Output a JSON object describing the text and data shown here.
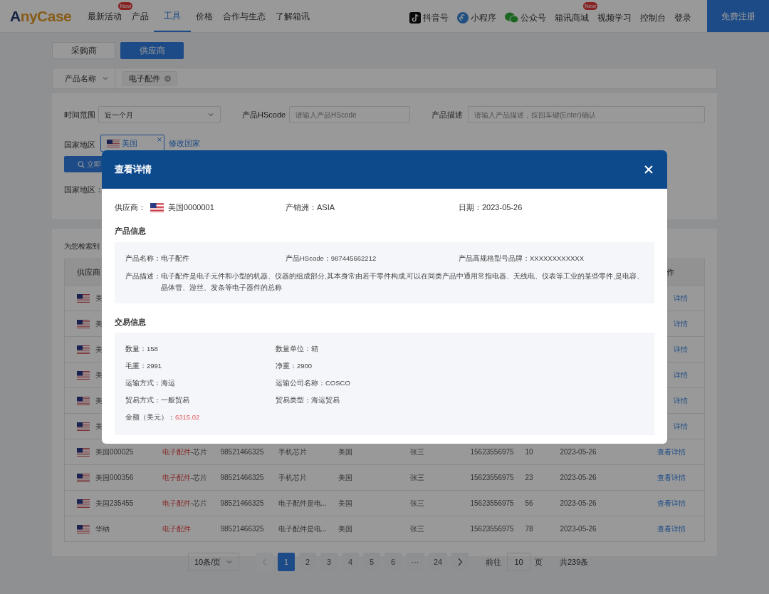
{
  "header": {
    "logo": "AnyCase",
    "nav": [
      {
        "label": "最新活动",
        "badge": "New",
        "selected": false
      },
      {
        "label": "产品",
        "selected": false
      },
      {
        "label": "工具",
        "selected": true
      },
      {
        "label": "价格",
        "selected": false
      },
      {
        "label": "合作与生态",
        "selected": false
      },
      {
        "label": "了解箱讯",
        "selected": false
      }
    ],
    "links": [
      {
        "label": "抖音号"
      },
      {
        "label": "小程序"
      },
      {
        "label": "公众号"
      },
      {
        "label": "箱讯商城",
        "badge": "New"
      },
      {
        "label": "视频学习"
      },
      {
        "label": "控制台"
      },
      {
        "label": "登录"
      }
    ],
    "register_button": "免费注册"
  },
  "role_tabs": [
    {
      "label": "采购商",
      "selected": false
    },
    {
      "label": "供应商",
      "selected": true
    }
  ],
  "filter_bar": {
    "field": "产品名称",
    "tag": "电子配件"
  },
  "filters": {
    "time_range": {
      "label": "时间范围",
      "value": "近一个月"
    },
    "hscode": {
      "label": "产品HScode",
      "placeholder": "请输入产品HScode"
    },
    "description": {
      "label": "产品描述",
      "placeholder": "请输入产品描述，按回车键(Enter)确认"
    },
    "country": {
      "label": "国家地区",
      "tag": "美国",
      "link": "修改国家"
    },
    "search_button": "立即",
    "country_summary": "国家地区："
  },
  "results": {
    "summary": "为您检索到",
    "columns": [
      "供应商",
      "作"
    ],
    "rows": [
      {
        "kind": "covered",
        "supplier": "美",
        "action": "详情"
      },
      {
        "kind": "covered",
        "supplier": "美",
        "action": "详情"
      },
      {
        "kind": "covered",
        "supplier": "美",
        "action": "详情"
      },
      {
        "kind": "covered",
        "supplier": "美",
        "action": "详情"
      },
      {
        "kind": "covered",
        "supplier": "美",
        "action": "详情"
      },
      {
        "kind": "covered",
        "supplier": "美",
        "action": "详情"
      },
      {
        "kind": "full",
        "supplier": "美国000025",
        "product": "电子配件",
        "product_suffix": "-芯片",
        "hscode": "98521466325",
        "description": "手机芯片",
        "country": "美国",
        "contact": "张三",
        "phone": "15623556975",
        "quantity": "10",
        "date": "2023-05-26",
        "action": "查看详情"
      },
      {
        "kind": "full",
        "supplier": "美国000356",
        "product": "电子配件",
        "product_suffix": "-芯片",
        "hscode": "98521466325",
        "description": "手机芯片",
        "country": "美国",
        "contact": "张三",
        "phone": "15623556975",
        "quantity": "23",
        "date": "2023-05-26",
        "action": "查看详情"
      },
      {
        "kind": "full",
        "supplier": "美国235455",
        "product": "电子配件",
        "product_suffix": "-芯片",
        "hscode": "98521466325",
        "description": "电子配件是电...",
        "country": "美国",
        "contact": "张三",
        "phone": "15623556975",
        "quantity": "56",
        "date": "2023-05-26",
        "action": "查看详情"
      },
      {
        "kind": "full",
        "supplier": "华纳",
        "product": "电子配件",
        "hscode": "98521466325",
        "description": "电子配件是电...",
        "country": "美国",
        "contact": "张三",
        "phone": "15623556975",
        "quantity": "78",
        "date": "2023-05-26",
        "action": "查看详情"
      }
    ]
  },
  "pagination": {
    "page_size": "10条/页",
    "prev": {
      "disabled": true
    },
    "pages": [
      {
        "label": "1",
        "selected": true
      },
      {
        "label": "2",
        "selected": false
      },
      {
        "label": "3",
        "selected": false
      },
      {
        "label": "4",
        "selected": false
      },
      {
        "label": "5",
        "selected": false
      },
      {
        "label": "6",
        "selected": false
      },
      {
        "label": "···",
        "selected": false
      },
      {
        "label": "24",
        "selected": false
      }
    ],
    "next": {
      "disabled": false
    },
    "goto_label": "前往",
    "goto_value": "10",
    "goto_unit": "页",
    "total": "共239条"
  },
  "modal": {
    "title": "查看详情",
    "summary": [
      {
        "label": "供应商：",
        "value": "美国0000001",
        "flag": true
      },
      {
        "label": "产销洲：",
        "value": "ASIA",
        "flag": false
      },
      {
        "label": "日期：",
        "value": "2023-05-26",
        "flag": false
      }
    ],
    "product_info": {
      "title": "产品信息",
      "fields": [
        {
          "label": "产品名称：",
          "value": "电子配件"
        },
        {
          "label": "产品HScode：",
          "value": "987445662212"
        },
        {
          "label": "产品高规格型号品牌：",
          "value": "XXXXXXXXXXXX"
        }
      ],
      "description": {
        "label": "产品描述：",
        "value": "电子配件是电子元件和小型的机器、仪器的组成部分,其本身常由若干零件构成,可以在同类产品中通用常指电器、无线电、仪表等工业的某些零件,是电容、晶体管、游丝、发条等电子器件的总称"
      }
    },
    "trade_info": {
      "title": "交易信息",
      "fields": [
        {
          "label": "数量：",
          "value": "158"
        },
        {
          "label": "数量单位：",
          "value": "箱"
        },
        {
          "label": "毛重：",
          "value": "2991"
        },
        {
          "label": "净重：",
          "value": "2900"
        },
        {
          "label": "运输方式：",
          "value": "海运"
        },
        {
          "label": "运输公司名称：",
          "value": "COSCO"
        },
        {
          "label": "贸易方式：",
          "value": "一般贸易"
        },
        {
          "label": "贸易类型：",
          "value": "海运贸易"
        }
      ],
      "amount": {
        "label": "金额（美元）：",
        "value": "6315.02"
      }
    }
  }
}
